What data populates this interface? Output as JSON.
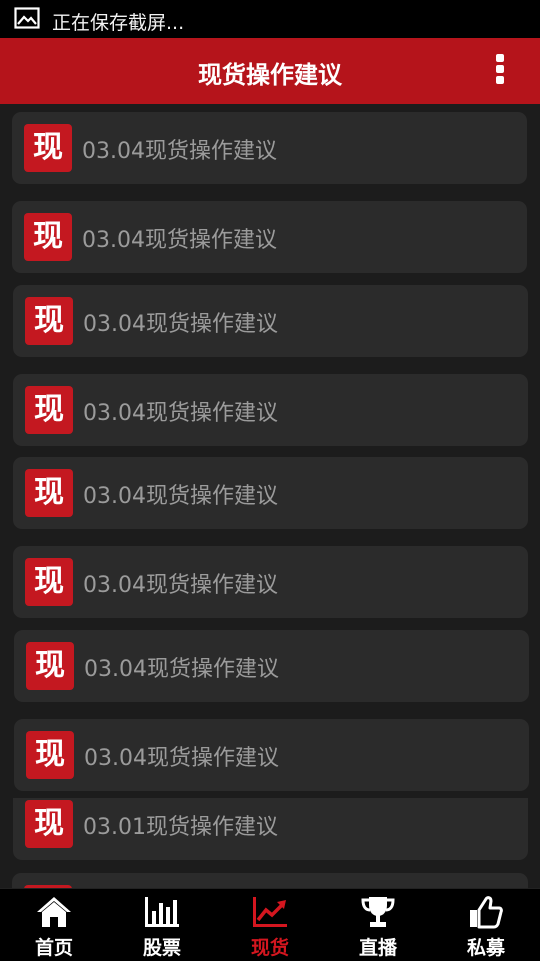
{
  "status_bar": {
    "icon": "image-icon",
    "text": "正在保存截屏..."
  },
  "header": {
    "title": "现货操作建议",
    "menu_icon": "overflow-menu-icon"
  },
  "list": {
    "items": [
      {
        "badge": "现",
        "title": "03.04现货操作建议"
      },
      {
        "badge": "现",
        "title": "03.04现货操作建议"
      },
      {
        "badge": "现",
        "title": "03.04现货操作建议"
      },
      {
        "badge": "现",
        "title": "03.04现货操作建议"
      },
      {
        "badge": "现",
        "title": "03.04现货操作建议"
      },
      {
        "badge": "现",
        "title": "03.04现货操作建议"
      },
      {
        "badge": "现",
        "title": "03.04现货操作建议"
      },
      {
        "badge": "现",
        "title": "03.04现货操作建议"
      },
      {
        "badge": "现",
        "title": "03.01现货操作建议"
      }
    ]
  },
  "tabbar": {
    "accent_color": "#d4161f",
    "active": "现货",
    "tabs": [
      {
        "label": "首页",
        "icon": "home-icon"
      },
      {
        "label": "股票",
        "icon": "bar-chart-icon"
      },
      {
        "label": "现货",
        "icon": "trend-line-icon"
      },
      {
        "label": "直播",
        "icon": "trophy-icon"
      },
      {
        "label": "私募",
        "icon": "thumbs-up-icon"
      }
    ]
  }
}
